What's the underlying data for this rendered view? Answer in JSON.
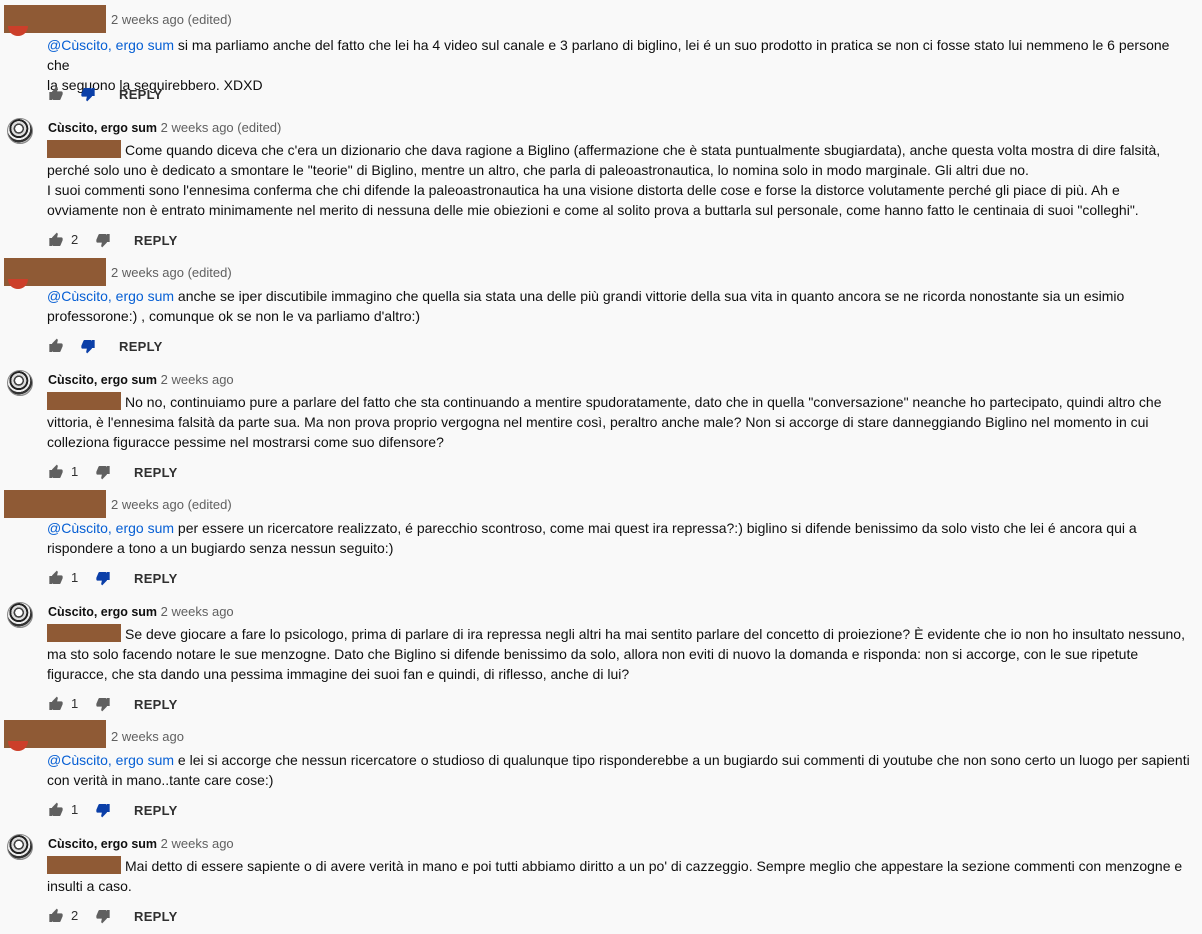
{
  "colors": {
    "mention": "#065fd4",
    "redaction": "#8f5a35",
    "dislike_active": "#0b3fa8",
    "icon_gray": "#606060"
  },
  "icons": {
    "like": "thumb-up-icon",
    "dislike": "thumb-down-icon"
  },
  "reply_label": "REPLY",
  "comments": [
    {
      "author": "",
      "time": "2 weeks ago (edited)",
      "mention": "@Cùscito, ergo sum",
      "line1": " si ma parliamo anche del fatto che lei ha 4 video sul canale e 3 parlano di biglino, lei é un suo prodotto in pratica se non ci fosse stato lui nemmeno le 6 persone che",
      "line2": "la seguono la seguirebbero. XDXD",
      "likes": "",
      "disliked": true
    },
    {
      "author": "Cùscito, ergo sum",
      "time": "2 weeks ago (edited)",
      "line1": "Come quando diceva che c'era un dizionario che dava ragione a Biglino (affermazione che è stata puntualmente sbugiardata), anche questa volta mostra di dire falsità,",
      "line2": "perché solo uno è dedicato a smontare le \"teorie\" di Biglino, mentre un altro, che parla di paleoastronautica, lo nomina solo in modo marginale. Gli altri due no.",
      "line3": "I suoi commenti sono l'ennesima conferma che chi difende la paleoastronautica ha una visione distorta delle cose e forse la distorce volutamente perché gli piace di più. Ah e",
      "line4": "ovviamente non è entrato minimamente nel merito di nessuna delle mie obiezioni e come al solito prova a buttarla sul personale, come hanno fatto le centinaia di suoi \"colleghi\".",
      "likes": "2",
      "disliked": false
    },
    {
      "author": "",
      "time": "2 weeks ago (edited)",
      "mention": "@Cùscito, ergo sum",
      "line1": " anche se iper discutibile immagino che quella sia stata una delle più grandi vittorie della sua vita in quanto ancora se ne ricorda nonostante sia un esimio",
      "line2": "professorone:) , comunque ok se non le va parliamo d'altro:)",
      "likes": "",
      "disliked": true
    },
    {
      "author": "Cùscito, ergo sum",
      "time": "2 weeks ago",
      "line1": "No no, continuiamo pure a parlare del fatto che sta continuando a mentire spudoratamente, dato che in quella \"conversazione\" neanche ho partecipato, quindi altro che",
      "line2": "vittoria, è l'ennesima falsità da parte sua. Ma non prova proprio vergogna nel mentire così, peraltro anche male? Non si accorge di stare danneggiando Biglino nel momento in cui",
      "line3": "colleziona figuracce pessime nel mostrarsi come suo difensore?",
      "likes": "1",
      "disliked": false
    },
    {
      "author": "",
      "time": "2 weeks ago (edited)",
      "mention": "@Cùscito, ergo sum",
      "line1": " per essere un ricercatore realizzato, é parecchio scontroso, come mai quest ira repressa?:) biglino si difende benissimo da solo visto che lei é ancora qui a",
      "line2": "rispondere a tono a un bugiardo senza nessun seguito:)",
      "likes": "1",
      "disliked": true
    },
    {
      "author": "Cùscito, ergo sum",
      "time": "2 weeks ago",
      "line1": "Se deve giocare a fare lo psicologo, prima di parlare di ira repressa negli altri ha mai sentito parlare del concetto di proiezione? È evidente che io non ho insultato nessuno,",
      "line2": "ma sto solo facendo notare le sue menzogne. Dato che Biglino si difende benissimo da solo, allora non eviti di nuovo la domanda e risponda: non si accorge, con le sue ripetute",
      "line3": "figuracce, che sta dando una pessima immagine dei suoi fan e quindi, di riflesso, anche di lui?",
      "likes": "1",
      "disliked": false
    },
    {
      "author": "",
      "time": "2 weeks ago",
      "mention": "@Cùscito, ergo sum",
      "line1": " e lei si accorge che nessun ricercatore o studioso di qualunque tipo risponderebbe a un bugiardo sui commenti di youtube che non sono certo un luogo per sapienti",
      "line2": "con verità in mano..tante care cose:)",
      "likes": "1",
      "disliked": true
    },
    {
      "author": "Cùscito, ergo sum",
      "time": "2 weeks ago",
      "line1": "Mai detto di essere sapiente o di avere verità in mano e poi tutti abbiamo diritto a un po' di cazzeggio. Sempre meglio che appestare la sezione commenti con menzogne e",
      "line2": "insulti a caso.",
      "likes": "2",
      "disliked": false
    }
  ]
}
